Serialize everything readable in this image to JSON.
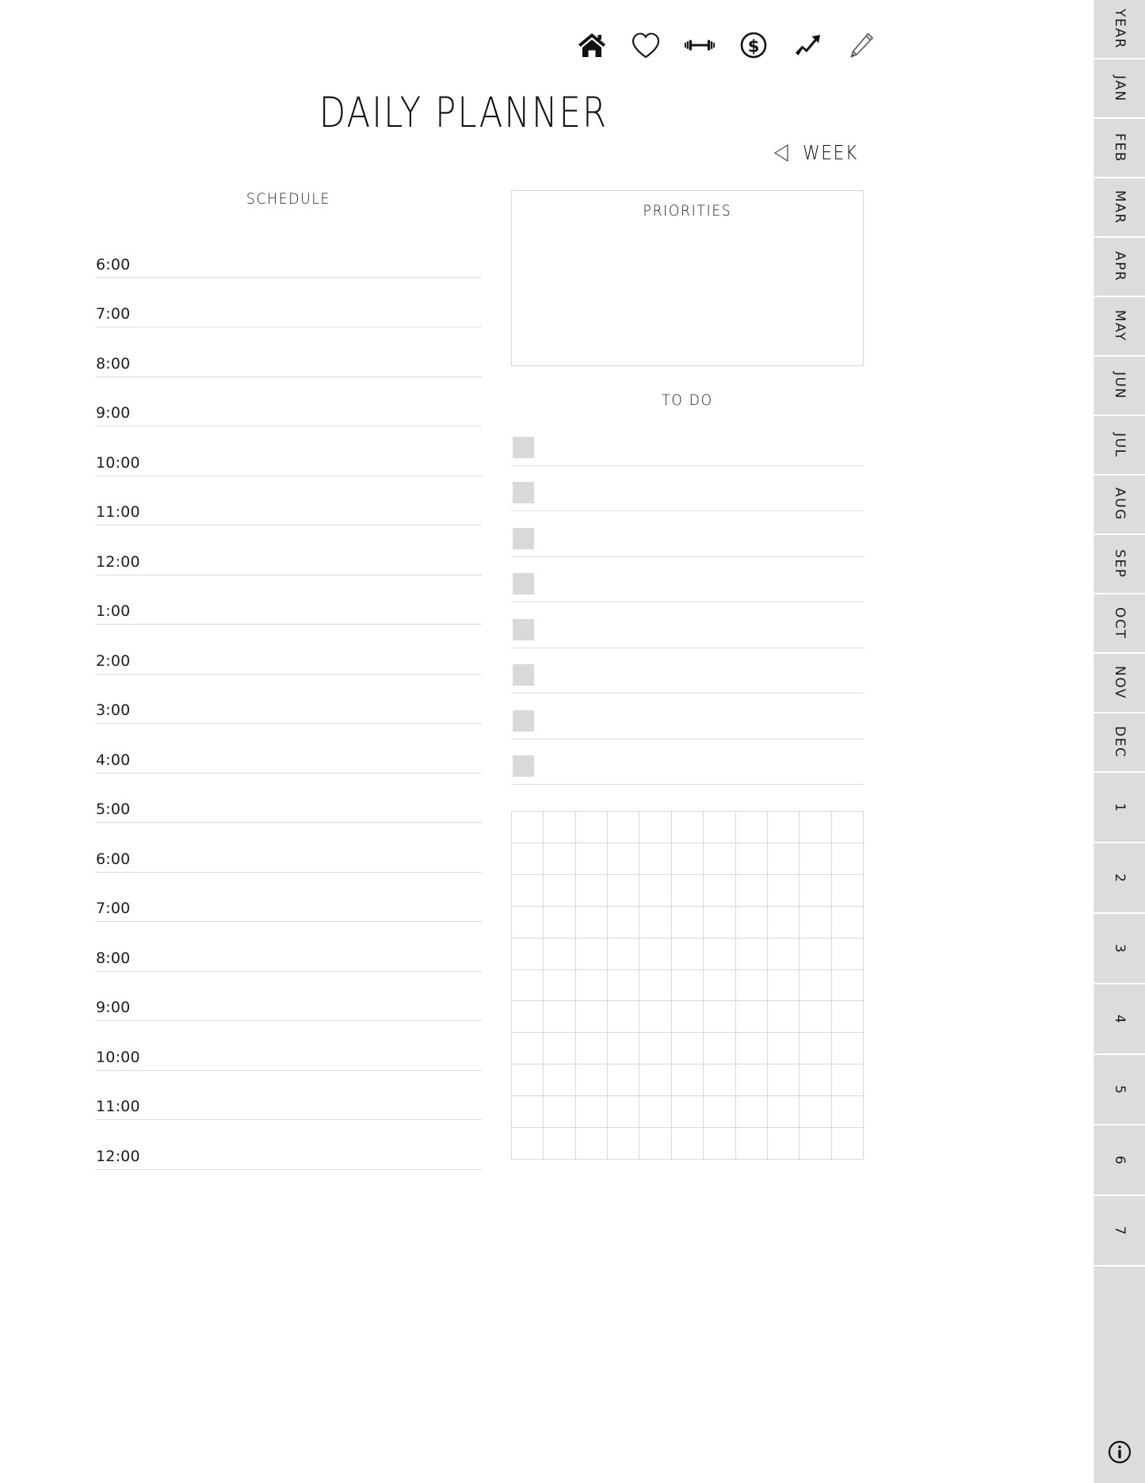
{
  "header": {
    "title": "DAILY PLANNER",
    "icons": [
      {
        "name": "home-icon",
        "label": "Home"
      },
      {
        "name": "heart-icon",
        "label": "Health"
      },
      {
        "name": "dumbbell-icon",
        "label": "Fitness"
      },
      {
        "name": "dollar-circle-icon",
        "label": "Finance"
      },
      {
        "name": "trending-up-arrow-icon",
        "label": "Goals"
      },
      {
        "name": "pencil-icon",
        "label": "Notes"
      }
    ]
  },
  "week_nav": {
    "arrow": "left-triangle-icon",
    "label": "WEEK"
  },
  "schedule": {
    "title": "SCHEDULE",
    "times": [
      "6:00",
      "7:00",
      "8:00",
      "9:00",
      "10:00",
      "11:00",
      "12:00",
      "1:00",
      "2:00",
      "3:00",
      "4:00",
      "5:00",
      "6:00",
      "7:00",
      "8:00",
      "9:00",
      "10:00",
      "11:00",
      "12:00"
    ]
  },
  "priorities": {
    "title": "PRIORITIES",
    "lines": 0
  },
  "todo": {
    "title": "TO DO",
    "items": [
      "",
      "",
      "",
      "",
      "",
      "",
      "",
      ""
    ]
  },
  "notes_grid": {
    "columns": 11,
    "rows": 11
  },
  "sidebar": {
    "month_tabs": [
      "YEAR",
      "JAN",
      "FEB",
      "MAR",
      "APR",
      "MAY",
      "JUN",
      "JUL",
      "AUG",
      "SEP",
      "OCT",
      "NOV",
      "DEC"
    ],
    "day_tabs": [
      "1",
      "2",
      "3",
      "4",
      "5",
      "6",
      "7"
    ],
    "info_icon": "info-circle-icon"
  },
  "colors": {
    "tab_gray": "#dcdcdc",
    "checkbox_gray": "#d9d9d9",
    "rule_gray": "#dddddd",
    "border_gray": "#d5d5d5",
    "text": "#1a1a1a",
    "page_bg": "#ffffff"
  }
}
